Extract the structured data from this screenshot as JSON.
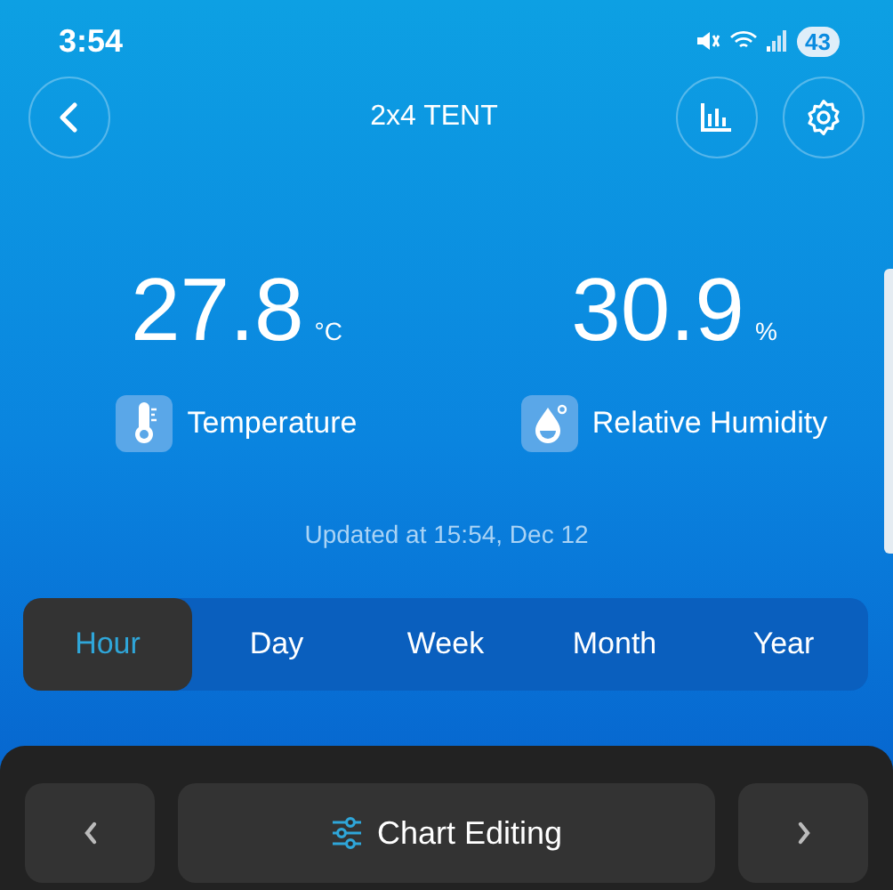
{
  "status_bar": {
    "time": "3:54",
    "battery": "43"
  },
  "header": {
    "title": "2x4 TENT"
  },
  "readings": [
    {
      "kind": "temperature",
      "value": "27.8",
      "unit": "°C",
      "label": "Temperature"
    },
    {
      "kind": "humidity",
      "value": "30.9",
      "unit": "%",
      "label": "Relative Humidity"
    }
  ],
  "updated": "Updated at 15:54, Dec 12",
  "tabs": [
    {
      "label": "Hour",
      "selected": true
    },
    {
      "label": "Day",
      "selected": false
    },
    {
      "label": "Week",
      "selected": false
    },
    {
      "label": "Month",
      "selected": false
    },
    {
      "label": "Year",
      "selected": false
    }
  ],
  "chart_editing": {
    "label": "Chart Editing"
  }
}
